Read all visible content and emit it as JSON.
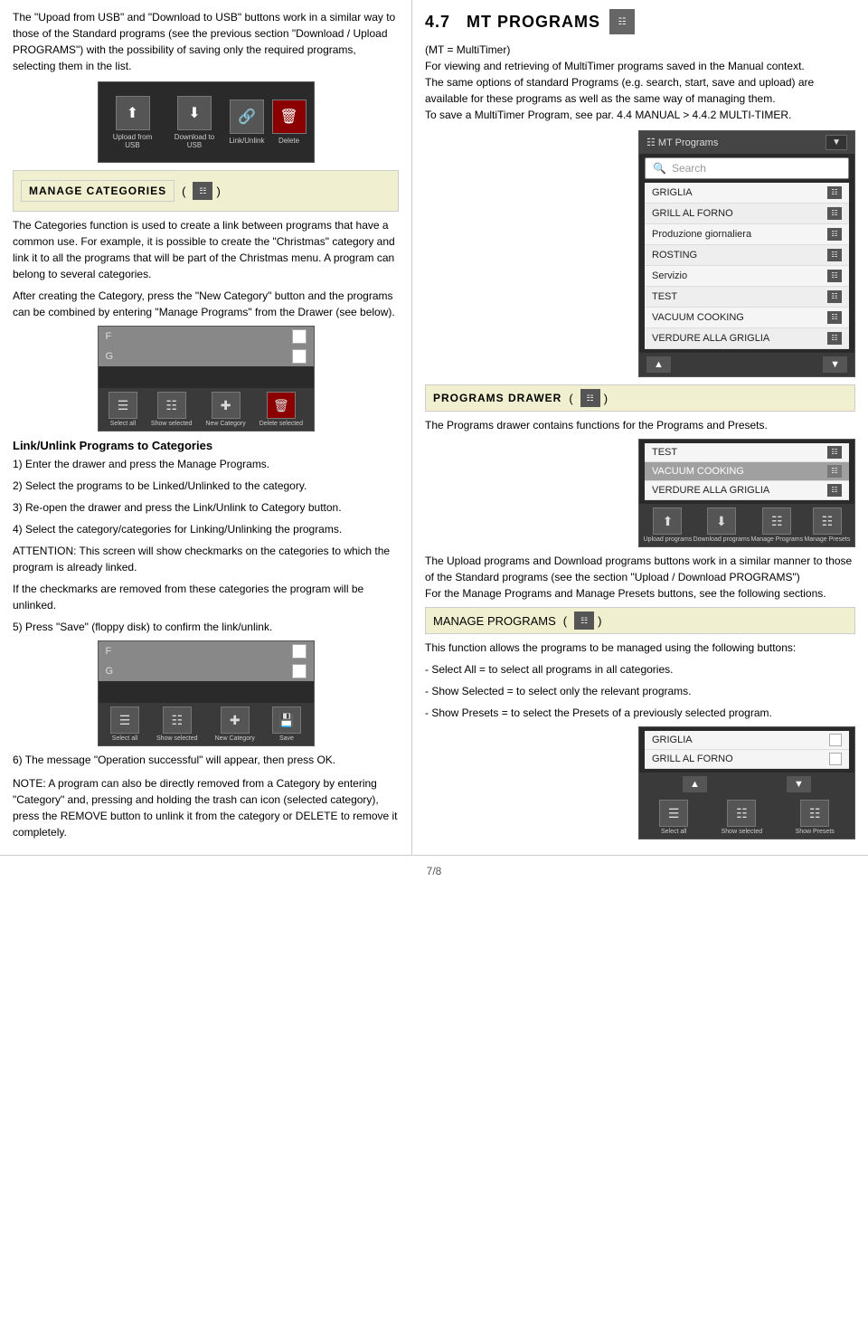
{
  "page": {
    "number": "7/8"
  },
  "left_col": {
    "intro_text": "The \"Upoad from USB\" and \"Download to USB\" buttons work in a similar way to those of the Standard programs (see the previous section \"Download / Upload PROGRAMS\") with the possibility of saving only the required programs, selecting them in the list.",
    "upload_btn": "Upload from USB",
    "download_btn": "Download to USB",
    "linkunlink_btn": "Link/Unlink",
    "delete_btn": "Delete",
    "manage_categories": {
      "title": "MANAGE CATEGORIES",
      "open_paren": "(",
      "close_paren": ")",
      "description": "The Categories function is used to create a link between programs that have a common use. For example, it is possible to create the \"Christmas\" category and link it to all the programs that will be part of the Christmas menu. A program can belong to several categories.",
      "after_creating": "After creating the Category, press the \"New Category\" button and the programs can be combined by entering \"Manage Programs\" from the Drawer (see below)."
    },
    "cat_screen": {
      "items": [
        "F",
        "G"
      ],
      "footer_buttons": [
        "Select all",
        "Show selected",
        "New Category",
        "Delete selected"
      ]
    },
    "link_unlink": {
      "title": "Link/Unlink Programs to Categories",
      "steps": [
        "1) Enter the drawer and press the Manage Programs.",
        "2) Select the programs to be Linked/Unlinked to the category.",
        "3) Re-open the drawer and press the Link/Unlink to Category button.",
        "4) Select the category/categories for Linking/Unlinking the programs.",
        "ATTENTION: This screen will show checkmarks on the categories to which the program is already linked.",
        "If the checkmarks are removed from these categories the program will be unlinked.",
        "5) Press \"Save\" (floppy disk) to confirm the link/unlink."
      ]
    },
    "cat_screen2": {
      "items": [
        "F",
        "G"
      ],
      "footer_buttons": [
        "Select all",
        "Show selected",
        "New Category",
        "Save"
      ]
    },
    "success_msg": "6) The message \"Operation successful\" will appear, then press OK.",
    "note": "NOTE: A program can also be directly removed from a Category by entering \"Category\" and, pressing and holding the trash can icon (selected category), press the REMOVE button to unlink it from the category or DELETE to remove it completely."
  },
  "right_col": {
    "section": {
      "number": "4.7",
      "title": "MT PROGRAMS"
    },
    "mt_description": "(MT = MultiTimer)\nFor viewing and retrieving of MultiTimer programs saved in the Manual context.\nThe same options of standard Programs (e.g. search, start, save and upload) are available for these programs as well as the same way of managing them.\nTo save a MultiTimer Program, see par. 4.4 MANUAL > 4.4.2 MULTI-TIMER.",
    "mt_screen": {
      "header": "MT Programs",
      "search_placeholder": "Search",
      "programs": [
        {
          "name": "GRIGLIA",
          "has_icon": true
        },
        {
          "name": "GRILL AL FORNO",
          "has_icon": true
        },
        {
          "name": "Produzione giornaliera",
          "has_icon": true
        },
        {
          "name": "ROSTING",
          "has_icon": true
        },
        {
          "name": "Servizio",
          "has_icon": true
        },
        {
          "name": "TEST",
          "has_icon": true
        },
        {
          "name": "VACUUM COOKING",
          "has_icon": true
        },
        {
          "name": "VERDURE ALLA GRIGLIA",
          "has_icon": true
        }
      ]
    },
    "programs_drawer": {
      "title": "PROGRAMS DRAWER",
      "open_paren": "(",
      "close_paren": ")",
      "description": "The Programs drawer contains functions for the Programs and Presets."
    },
    "drawer_screen": {
      "programs": [
        {
          "name": "TEST",
          "active": false
        },
        {
          "name": "VACUUM COOKING",
          "active": true
        },
        {
          "name": "VERDURE ALLA GRIGLIA",
          "active": false
        }
      ],
      "buttons": [
        "Upload programs",
        "Download programs",
        "Manage Programs",
        "Manage Presets"
      ]
    },
    "drawer_description": "The Upload programs and Download programs buttons work in a similar manner to those of the Standard programs (see the section \"Upload / Download PROGRAMS\")\nFor the Manage Programs and Manage Presets buttons, see the following sections.",
    "manage_programs": {
      "title": "MANAGE PROGRAMS",
      "open_paren": "(",
      "close_paren": ")",
      "description": "This function allows the programs to be managed using the following buttons:",
      "bullets": [
        "- Select All = to select all programs in all categories.",
        "- Show Selected = to select only the relevant programs.",
        "- Show Presets = to select the Presets of a previously selected program."
      ]
    },
    "final_screen": {
      "programs": [
        {
          "name": "GRIGLIA",
          "checked": false
        },
        {
          "name": "GRILL AL FORNO",
          "checked": false
        }
      ],
      "buttons": [
        "Select all",
        "Show selected",
        "Show Presets"
      ]
    }
  }
}
